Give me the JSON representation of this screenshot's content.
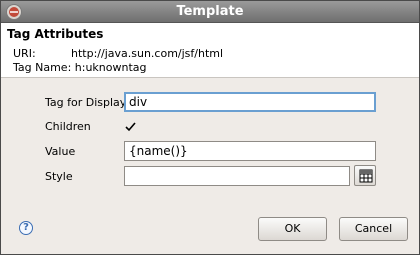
{
  "window": {
    "title": "Template"
  },
  "header": {
    "title": "Tag Attributes",
    "uri_label": "URI:",
    "uri_value": "http://java.sun.com/jsf/html",
    "tag_name_label": "Tag Name:",
    "tag_name_value": "h:uknowntag"
  },
  "form": {
    "tag_for_display_label": "Tag for Display",
    "tag_for_display_value": "div",
    "children_label": "Children",
    "children_checked": true,
    "value_label": "Value",
    "value_value": "{name()}",
    "style_label": "Style",
    "style_value": ""
  },
  "buttons": {
    "ok": "OK",
    "cancel": "Cancel",
    "help": "?"
  },
  "icons": {
    "title": "eclipse-icon",
    "browse": "style-editor-icon",
    "help": "help-icon"
  }
}
